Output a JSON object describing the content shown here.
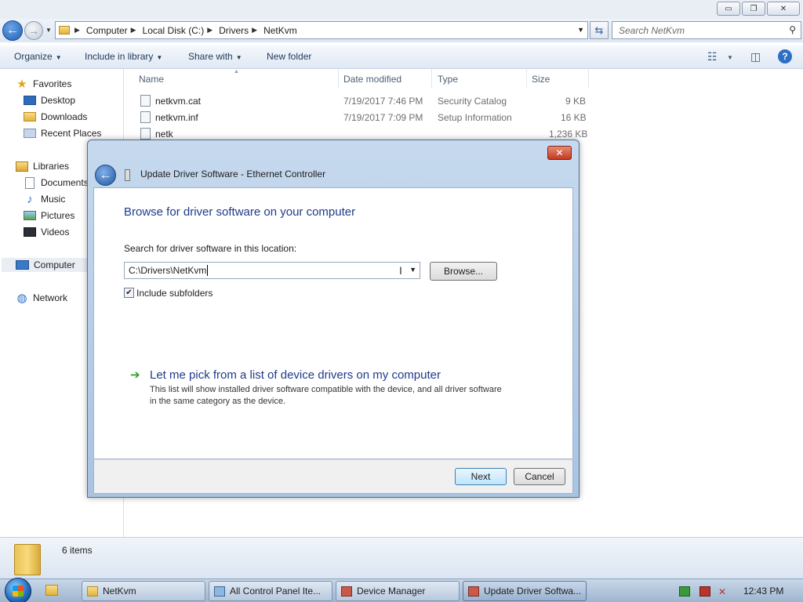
{
  "explorer": {
    "caption": {
      "minimize": "▭",
      "maximize": "❐",
      "close": "✕"
    },
    "address": {
      "crumbs": [
        "Computer",
        "Local Disk (C:)",
        "Drivers",
        "NetKvm"
      ],
      "search_placeholder": "Search NetKvm"
    },
    "toolbar": {
      "organize": "Organize",
      "include_in_library": "Include in library",
      "share_with": "Share with",
      "new_folder": "New folder"
    },
    "nav": {
      "favorites": "Favorites",
      "desktop": "Desktop",
      "downloads": "Downloads",
      "recent_places": "Recent Places",
      "libraries": "Libraries",
      "documents": "Documents",
      "music": "Music",
      "pictures": "Pictures",
      "videos": "Videos",
      "computer": "Computer",
      "network": "Network"
    },
    "columns": {
      "name": "Name",
      "date_modified": "Date modified",
      "type": "Type",
      "size": "Size"
    },
    "files": [
      {
        "name": "netkvm.cat",
        "date": "7/19/2017 7:46 PM",
        "type": "Security Catalog",
        "size": "9 KB"
      },
      {
        "name": "netkvm.inf",
        "date": "7/19/2017 7:09 PM",
        "type": "Setup Information",
        "size": "16 KB"
      },
      {
        "name": "netk",
        "date": "",
        "type": "",
        "size": "1,236 KB"
      }
    ],
    "status": {
      "items": "6 items"
    }
  },
  "dialog": {
    "title": "Update Driver Software - Ethernet Controller",
    "close": "✕",
    "heading": "Browse for driver software on your computer",
    "search_label": "Search for driver software in this location:",
    "path": "C:\\Drivers\\NetKvm",
    "browse": "Browse...",
    "include_subfolders": "Include subfolders",
    "include_subfolders_checked": true,
    "pick_link": "Let me pick from a list of device drivers on my computer",
    "pick_desc": "This list will show installed driver software compatible with the device, and all driver software in the same category as the device.",
    "next": "Next",
    "cancel": "Cancel"
  },
  "taskbar": {
    "buttons": [
      {
        "label": "NetKvm"
      },
      {
        "label": "All Control Panel Ite..."
      },
      {
        "label": "Device Manager"
      },
      {
        "label": "Update Driver Softwa..."
      }
    ],
    "clock": "12:43 PM"
  }
}
